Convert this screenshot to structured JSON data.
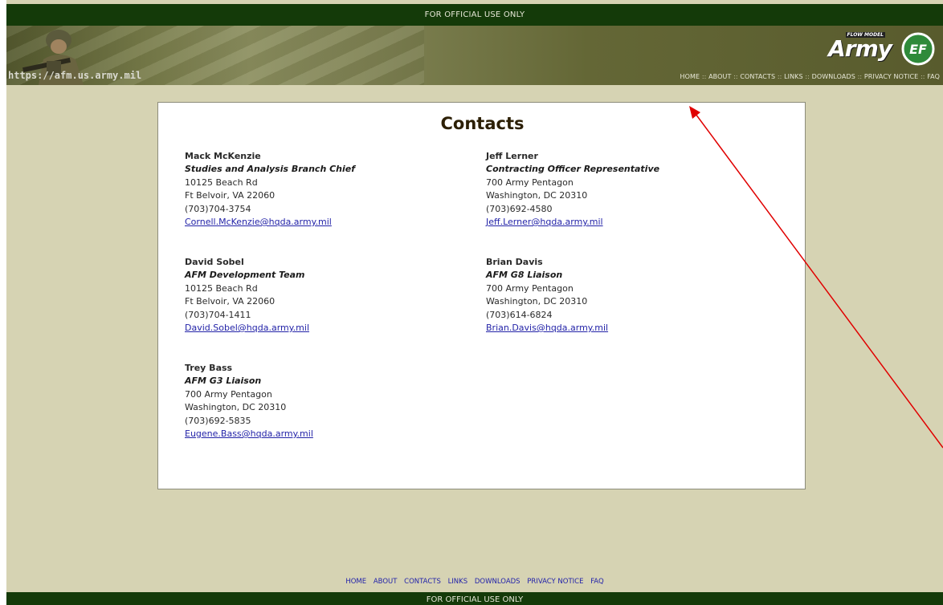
{
  "header": {
    "classification": "FOR OFFICIAL USE ONLY",
    "url": "https://afm.us.army.mil",
    "logo_tag": "FLOW MODEL",
    "logo_text": "Army",
    "nav": [
      "HOME",
      "ABOUT",
      "CONTACTS",
      "LINKS",
      "DOWNLOADS",
      "PRIVACY NOTICE",
      "FAQ"
    ],
    "nav_separator": "::"
  },
  "main": {
    "title": "Contacts",
    "contacts": [
      {
        "name": "Mack McKenzie",
        "role": "Studies and Analysis Branch Chief",
        "address1": "10125 Beach Rd",
        "address2": "Ft Belvoir, VA  22060",
        "phone": "(703)704-3754",
        "email": "Cornell.McKenzie@hqda.army.mil"
      },
      {
        "name": "Jeff Lerner",
        "role": "Contracting Officer Representative",
        "address1": "700 Army Pentagon",
        "address2": "Washington, DC  20310",
        "phone": "(703)692-4580",
        "email": "Jeff.Lerner@hqda.army.mil"
      },
      {
        "name": "David Sobel",
        "role": "AFM Development Team",
        "address1": "10125 Beach Rd",
        "address2": "Ft Belvoir, VA  22060",
        "phone": "(703)704-1411",
        "email": "David.Sobel@hqda.army.mil"
      },
      {
        "name": "Brian Davis",
        "role": "AFM G8 Liaison",
        "address1": "700 Army Pentagon",
        "address2": "Washington, DC  20310",
        "phone": "(703)614-6824",
        "email": "Brian.Davis@hqda.army.mil"
      },
      {
        "name": "Trey Bass",
        "role": "AFM G3 Liaison",
        "address1": "700 Army Pentagon",
        "address2": "Washington, DC  20310",
        "phone": "(703)692-5835",
        "email": "Eugene.Bass@hqda.army.mil"
      }
    ]
  },
  "footer": {
    "nav": [
      "HOME",
      "ABOUT",
      "CONTACTS",
      "LINKS",
      "DOWNLOADS",
      "PRIVACY NOTICE",
      "FAQ"
    ],
    "classification": "FOR OFFICIAL USE ONLY"
  },
  "colors": {
    "top_bar": "#143a09",
    "background": "#d6d3b3",
    "link": "#2323a8",
    "title": "#2c1f05",
    "annotation_arrow": "#e00000"
  },
  "icons": {
    "soldier": "soldier-photo-icon",
    "army_logo": "army-flow-model-logo-icon",
    "ef_logo": "ef-circle-logo-icon"
  }
}
